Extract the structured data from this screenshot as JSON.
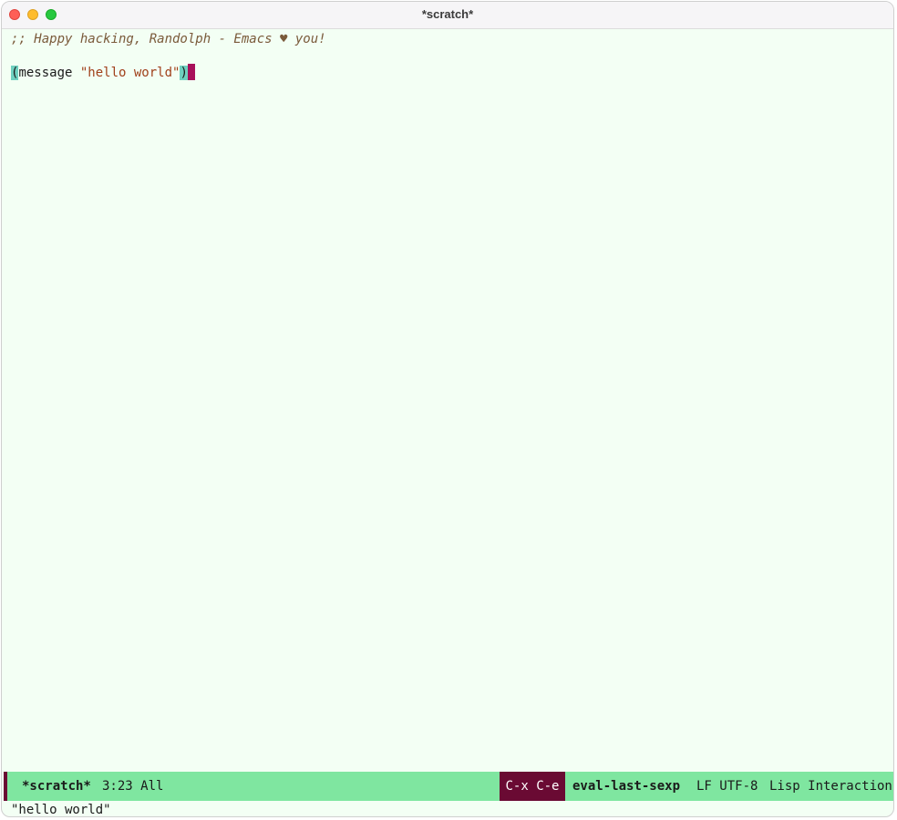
{
  "window": {
    "title": "*scratch*"
  },
  "buffer": {
    "comment_line": ";; Happy hacking, Randolph - Emacs ♥ you!",
    "code": {
      "open_paren": "(",
      "function": "message ",
      "string": "\"hello world\"",
      "close_paren": ")"
    }
  },
  "modeline": {
    "buffer_name": "*scratch*",
    "position": "3:23 All",
    "key_sequence": "C-x C-e",
    "command": "eval-last-sexp",
    "encoding": "LF UTF-8",
    "major_mode": "Lisp Interaction"
  },
  "echo_area": {
    "message": "\"hello world\""
  },
  "colors": {
    "buffer_bg": "#f3fff4",
    "modeline_bg": "#7fe6a0",
    "accent": "#6a0a33",
    "cursor": "#a8105a",
    "paren_match": "#6fd0c0"
  }
}
